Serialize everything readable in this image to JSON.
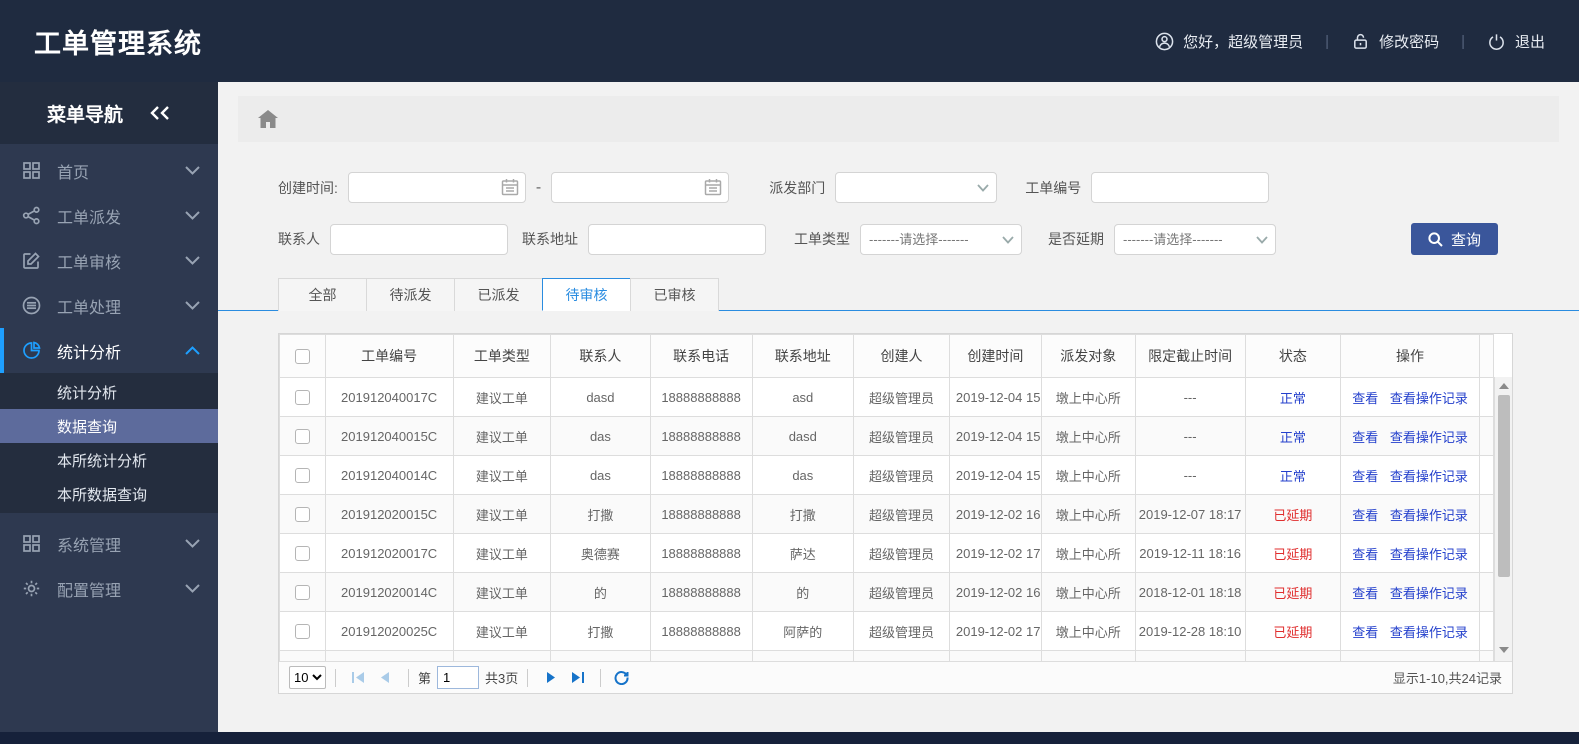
{
  "header": {
    "title": "工单管理系统",
    "greeting": "您好，超级管理员",
    "change_password": "修改密码",
    "logout": "退出",
    "separator": "|"
  },
  "sidebar": {
    "title": "菜单导航",
    "items": [
      {
        "label": "首页",
        "icon": "grid-icon"
      },
      {
        "label": "工单派发",
        "icon": "share-icon"
      },
      {
        "label": "工单审核",
        "icon": "edit-icon"
      },
      {
        "label": "工单处理",
        "icon": "stack-icon"
      },
      {
        "label": "统计分析",
        "icon": "pie-chart-icon",
        "expanded": true,
        "children": [
          "统计分析",
          "数据查询",
          "本所统计分析",
          "本所数据查询"
        ],
        "active_child": "数据查询"
      },
      {
        "label": "系统管理",
        "icon": "apps-icon"
      },
      {
        "label": "配置管理",
        "icon": "gear-icon"
      }
    ],
    "accent_color": "#1e9fff"
  },
  "filters": {
    "create_time_label": "创建时间:",
    "date_separator": "-",
    "dispatch_dept_label": "派发部门",
    "order_no_label": "工单编号",
    "contact_label": "联系人",
    "address_label": "联系地址",
    "order_type_label": "工单类型",
    "order_type_value": "-------请选择-------",
    "delay_label": "是否延期",
    "delay_value": "-------请选择-------",
    "search_button": "查询"
  },
  "tabs": [
    {
      "label": "全部",
      "active": false
    },
    {
      "label": "待派发",
      "active": false
    },
    {
      "label": "已派发",
      "active": false
    },
    {
      "label": "待审核",
      "active": true
    },
    {
      "label": "已审核",
      "active": false
    }
  ],
  "table": {
    "columns": [
      "工单编号",
      "工单类型",
      "联系人",
      "联系电话",
      "联系地址",
      "创建人",
      "创建时间",
      "派发对象",
      "限定截止时间",
      "状态",
      "操作"
    ],
    "action_labels": [
      "查看",
      "查看操作记录"
    ],
    "status_colors": {
      "normal": "#2440cc",
      "delayed": "#e02e2e"
    },
    "rows": [
      {
        "order_no": "201912040017C",
        "order_type": "建议工单",
        "contact": "dasd",
        "phone": "18888888888",
        "address": "asd",
        "creator": "超级管理员",
        "create_time": "2019-12-04 15",
        "dispatch_target": "墩上中心所",
        "deadline": "---",
        "status": "正常",
        "status_type": "normal"
      },
      {
        "order_no": "201912040015C",
        "order_type": "建议工单",
        "contact": "das",
        "phone": "18888888888",
        "address": "dasd",
        "creator": "超级管理员",
        "create_time": "2019-12-04 15",
        "dispatch_target": "墩上中心所",
        "deadline": "---",
        "status": "正常",
        "status_type": "normal"
      },
      {
        "order_no": "201912040014C",
        "order_type": "建议工单",
        "contact": "das",
        "phone": "18888888888",
        "address": "das",
        "creator": "超级管理员",
        "create_time": "2019-12-04 15",
        "dispatch_target": "墩上中心所",
        "deadline": "---",
        "status": "正常",
        "status_type": "normal"
      },
      {
        "order_no": "201912020015C",
        "order_type": "建议工单",
        "contact": "打撒",
        "phone": "18888888888",
        "address": "打撒",
        "creator": "超级管理员",
        "create_time": "2019-12-02 16",
        "dispatch_target": "墩上中心所",
        "deadline": "2019-12-07 18:17",
        "status": "已延期",
        "status_type": "delayed"
      },
      {
        "order_no": "201912020017C",
        "order_type": "建议工单",
        "contact": "奥德赛",
        "phone": "18888888888",
        "address": "萨达",
        "creator": "超级管理员",
        "create_time": "2019-12-02 17",
        "dispatch_target": "墩上中心所",
        "deadline": "2019-12-11 18:16",
        "status": "已延期",
        "status_type": "delayed"
      },
      {
        "order_no": "201912020014C",
        "order_type": "建议工单",
        "contact": "的",
        "phone": "18888888888",
        "address": "的",
        "creator": "超级管理员",
        "create_time": "2019-12-02 16",
        "dispatch_target": "墩上中心所",
        "deadline": "2018-12-01 18:18",
        "status": "已延期",
        "status_type": "delayed"
      },
      {
        "order_no": "201912020025C",
        "order_type": "建议工单",
        "contact": "打撒",
        "phone": "18888888888",
        "address": "阿萨的",
        "creator": "超级管理员",
        "create_time": "2019-12-02 17",
        "dispatch_target": "墩上中心所",
        "deadline": "2019-12-28 18:10",
        "status": "已延期",
        "status_type": "delayed"
      }
    ]
  },
  "pagination": {
    "page_size": "10",
    "page_prefix": "第",
    "current_page": "1",
    "total_pages": "共3页",
    "summary": "显示1-10,共24记录"
  }
}
